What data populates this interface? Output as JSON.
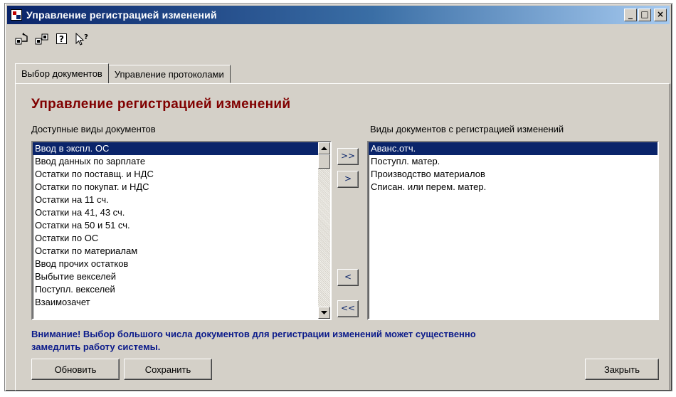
{
  "window": {
    "title": "Управление регистрацией изменений",
    "controls": {
      "minimize": "_",
      "maximize": "□",
      "close": "×"
    }
  },
  "toolbar": {
    "icons": [
      "open-icon",
      "save-icon",
      "help-icon",
      "context-help-icon"
    ],
    "help_glyph": "?"
  },
  "tabs": [
    {
      "label": "Выбор документов",
      "active": true
    },
    {
      "label": "Управление протоколами",
      "active": false
    }
  ],
  "panel": {
    "title": "Управление регистрацией изменений",
    "available_label": "Доступные виды документов",
    "selected_label": "Виды документов с регистрацией изменений",
    "available_items": [
      "Ввод в экспл. ОС",
      "Ввод данных по зарплате",
      "Остатки по поставщ. и НДС",
      "Остатки по покупат. и НДС",
      "Остатки на 11 сч.",
      "Остатки на 41, 43 сч.",
      "Остатки на 50 и 51 сч.",
      "Остатки по ОС",
      "Остатки по материалам",
      "Ввод прочих остатков",
      "Выбытие векселей",
      "Поступл. векселей",
      "Взаимозачет"
    ],
    "available_selected_index": 0,
    "selected_items": [
      "Аванс.отч.",
      "Поступл. матер.",
      "Производство материалов",
      "Списан. или перем. матер."
    ],
    "selected_selected_index": 0,
    "move_buttons": {
      "add_all": ">>",
      "add_one": ">",
      "remove_one": "<",
      "remove_all": "<<"
    },
    "warning_line1": "Внимание! Выбор большого числа документов для регистрации изменений может существенно",
    "warning_line2": "замедлить работу системы.",
    "buttons": {
      "refresh": "Обновить",
      "save": "Сохранить",
      "close": "Закрыть"
    }
  },
  "colors": {
    "title_text": "#800000",
    "warning_text": "#0a1a8a",
    "selection": "#0a246a",
    "face": "#d4d0c8"
  }
}
